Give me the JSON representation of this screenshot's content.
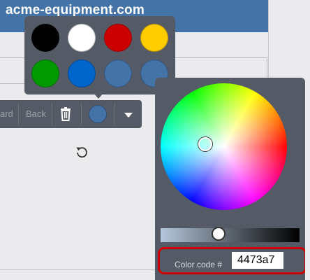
{
  "header": {
    "title": "acme-equipment.com"
  },
  "swatches": [
    {
      "name": "black",
      "color": "#000000"
    },
    {
      "name": "white",
      "color": "#ffffff"
    },
    {
      "name": "red",
      "color": "#cc0000"
    },
    {
      "name": "yellow",
      "color": "#ffcc00"
    },
    {
      "name": "green",
      "color": "#009900"
    },
    {
      "name": "blue",
      "color": "#0066cc"
    },
    {
      "name": "custom-1",
      "color": "#4473a7"
    },
    {
      "name": "custom-2",
      "color": "#4473a7"
    }
  ],
  "toolbar": {
    "forward_label": "ard",
    "back_label": "Back",
    "current_color": "#4473a7"
  },
  "picker": {
    "color_code_label": "Color code #",
    "color_code_value": "4473a7"
  },
  "colors": {
    "brand": "#4473a7",
    "panel": "#555b66",
    "highlight": "#d00000"
  }
}
